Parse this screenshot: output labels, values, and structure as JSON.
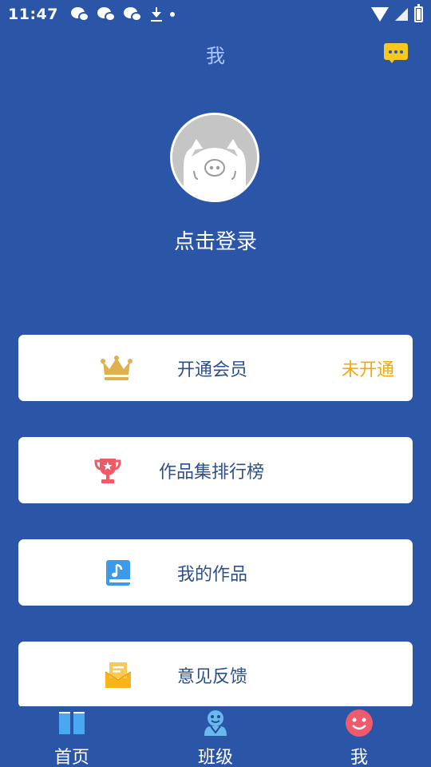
{
  "status_bar": {
    "time": "11:47",
    "left_icons": [
      "wechat-icon",
      "wechat-icon",
      "wechat-icon",
      "download-icon",
      "dot-icon"
    ],
    "right_icons": [
      "wifi-icon",
      "signal-icon",
      "battery-icon"
    ]
  },
  "header": {
    "title": "我",
    "message_icon": "message-icon",
    "accent_color": "#f7c81f"
  },
  "profile": {
    "avatar_icon": "pig-avatar-icon",
    "login_label": "点击登录"
  },
  "menu": [
    {
      "label": "开通会员",
      "icon": "crown-icon",
      "status": "未开通"
    },
    {
      "label": "作品集排行榜",
      "icon": "trophy-icon"
    },
    {
      "label": "我的作品",
      "icon": "music-book-icon"
    },
    {
      "label": "意见反馈",
      "icon": "feedback-mail-icon"
    }
  ],
  "bottom_nav": [
    {
      "label": "首页",
      "icon": "book-icon"
    },
    {
      "label": "班级",
      "icon": "class-icon"
    },
    {
      "label": "我",
      "icon": "smiley-icon",
      "active": true
    }
  ],
  "colors": {
    "background": "#2b56a7",
    "card": "#ffffff",
    "card_text": "#2d4f8d",
    "status_text": "#f2a90a"
  }
}
